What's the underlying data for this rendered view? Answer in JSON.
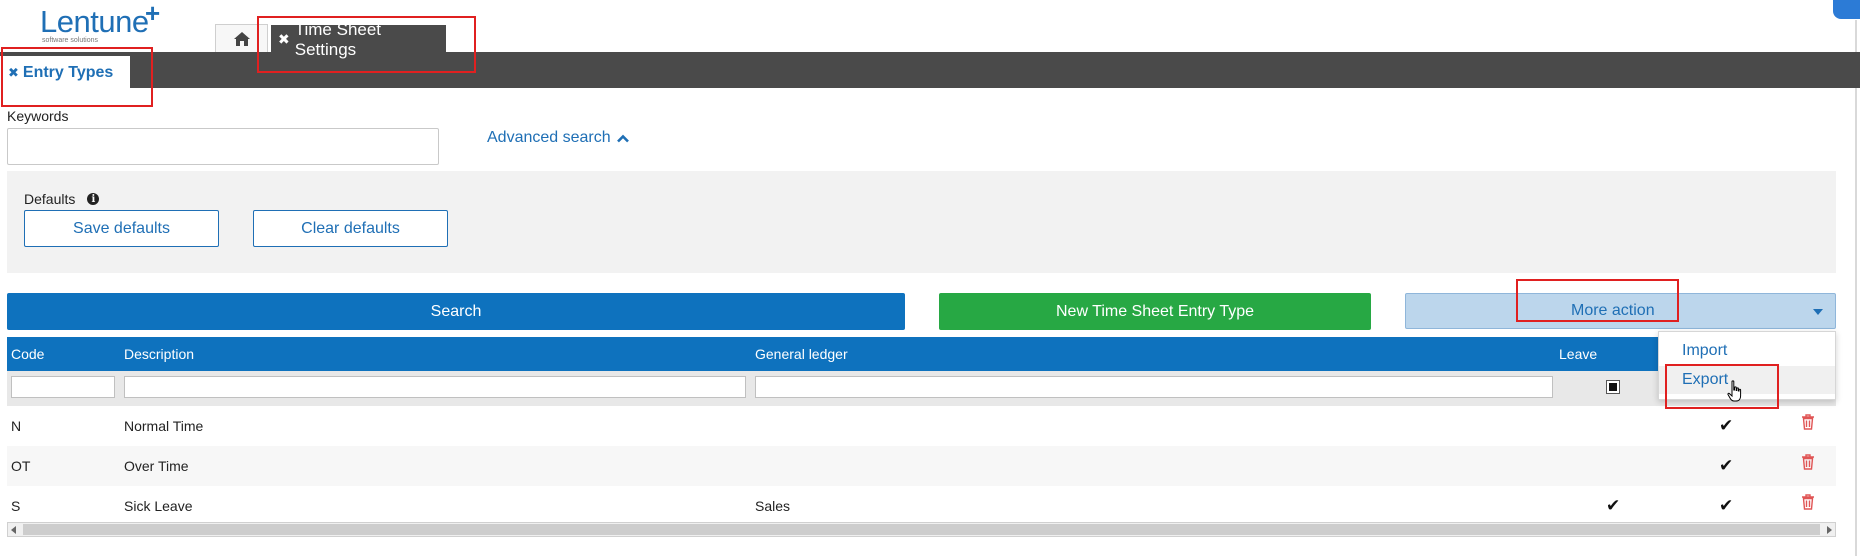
{
  "logo": {
    "name": "Lentune",
    "plus": "+",
    "tagline": "software solutions"
  },
  "tabs": {
    "home_icon": "home-icon",
    "time_sheet_settings": {
      "close": "✖",
      "label": "Time Sheet Settings"
    },
    "entry_types": {
      "close": "✖",
      "label": "Entry Types"
    }
  },
  "search": {
    "keywords_label": "Keywords",
    "keywords_value": "",
    "advanced_search": "Advanced search"
  },
  "defaults": {
    "label": "Defaults",
    "info_icon": "info-icon",
    "save_label": "Save defaults",
    "clear_label": "Clear defaults"
  },
  "actions": {
    "search_label": "Search",
    "new_label": "New Time Sheet Entry Type",
    "more_label": "More action",
    "more_menu": [
      "Import",
      "Export"
    ]
  },
  "table": {
    "columns": [
      "Code",
      "Description",
      "General ledger",
      "Leave"
    ],
    "rows": [
      {
        "code": "N",
        "description": "Normal Time",
        "ledger": "",
        "leave": false,
        "active": true
      },
      {
        "code": "OT",
        "description": "Over Time",
        "ledger": "",
        "leave": false,
        "active": true
      },
      {
        "code": "S",
        "description": "Sick Leave",
        "ledger": "Sales",
        "leave": true,
        "active": true
      }
    ],
    "check_glyph": "✔",
    "delete_icon": "trash-icon"
  },
  "colors": {
    "primary": "#0e72be",
    "success": "#27a844",
    "more_bg": "#bcd6ec",
    "dark_bar": "#4a4a4a",
    "danger": "#e05555",
    "annotation": "#e02020"
  }
}
